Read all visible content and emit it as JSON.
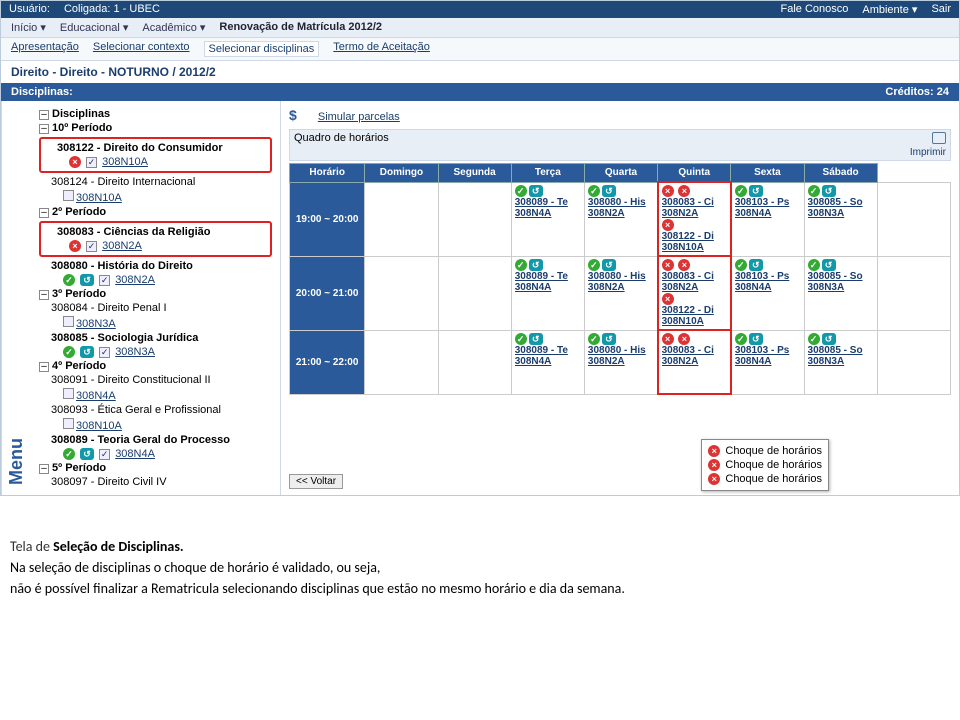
{
  "topbar": {
    "usuario_label": "Usuário:",
    "coligada": "Coligada: 1 - UBEC",
    "fale": "Fale Conosco",
    "ambiente": "Ambiente ▾",
    "sair": "Sair"
  },
  "topnav": {
    "inicio": "Início ▾",
    "educacional": "Educacional ▾",
    "academico": "Acadêmico ▾",
    "renovacao": "Renovação de Matrícula 2012/2"
  },
  "subnav": {
    "apresentacao": "Apresentação",
    "contexto": "Selecionar contexto",
    "disciplinas": "Selecionar disciplinas",
    "termo": "Termo de Aceitação"
  },
  "context_line": "Direito - Direito - NOTURNO / 2012/2",
  "bar": {
    "disciplinas": "Disciplinas:",
    "creditos": "Créditos: 24"
  },
  "menu_label": "Menu",
  "tree": {
    "root": "Disciplinas",
    "p10": "10º Período",
    "d308122": "308122 - Direito do Consumidor",
    "s308N10A": "308N10A",
    "d308124": "308124 - Direito Internacional",
    "p2": "2º Período",
    "d308083": "308083 - Ciências da Religião",
    "s308N2A": "308N2A",
    "d308080": "308080 - História do Direito",
    "p3": "3º Período",
    "d308084": "308084 - Direito Penal I",
    "s308N3A": "308N3A",
    "d308085": "308085 - Sociologia Jurídica",
    "p4": "4º Período",
    "d308091": "308091 - Direito Constitucional II",
    "s308N4A": "308N4A",
    "d308093": "308093 - Ética Geral e Profissional",
    "d308089": "308089 - Teoria Geral do Processo",
    "p5": "5º Período",
    "d308097": "308097 - Direito Civil IV"
  },
  "right": {
    "simular": "Simular parcelas",
    "quadro": "Quadro de horários",
    "imprimir": "Imprimir",
    "voltar": "<< Voltar"
  },
  "sched": {
    "headers": [
      "Horário",
      "Domingo",
      "Segunda",
      "Terça",
      "Quarta",
      "Quinta",
      "Sexta",
      "Sábado"
    ],
    "rows": [
      {
        "time": "19:00 ~ 20:00"
      },
      {
        "time": "20:00 ~ 21:00"
      },
      {
        "time": "21:00 ~ 22:00"
      }
    ],
    "c308089": "308089 - Te",
    "c308N4A": "308N4A",
    "c308080": "308080 - His",
    "c308N2A": "308N2A",
    "c308083": "308083 - Ci",
    "c308122": "308122 - Di",
    "c308N10A": "308N10A",
    "c308103": "308103 - Ps",
    "c308085": "308085 - So",
    "c308N3A": "308N3A"
  },
  "tooltip": {
    "line": "Choque de horários"
  },
  "caption": {
    "l1a": "Tela de ",
    "l1b": "Seleção de Disciplinas.",
    "l2": "Na seleção de disciplinas o choque de horário é validado, ou seja,",
    "l3": "não é possível finalizar a Rematricula selecionando disciplinas que estão no mesmo horário e dia da semana."
  }
}
